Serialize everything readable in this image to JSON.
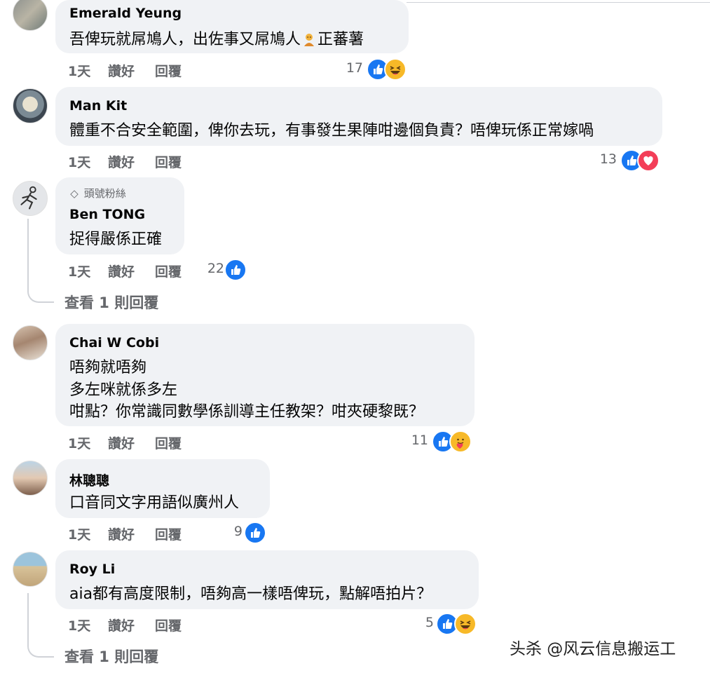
{
  "comments": [
    {
      "author": "Emerald Yeung",
      "text_parts": [
        "吾俾玩就屌鳩人，出佐事又屌鳩人",
        "正蕃薯"
      ],
      "actions": {
        "time": "1天",
        "like": "讚好",
        "reply": "回覆"
      },
      "reaction_count": "17",
      "reactions": [
        "like-icon",
        "haha-icon"
      ]
    },
    {
      "author": "Man Kit",
      "lines": [
        "體重不合安全範圍，俾你去玩，有事發生果陣咁邊個負責？唔俾玩係正常嫁喎"
      ],
      "actions": {
        "time": "1天",
        "like": "讚好",
        "reply": "回覆"
      },
      "reaction_count": "13",
      "reactions": [
        "like-icon",
        "love-icon"
      ]
    },
    {
      "badge": "頭號粉絲",
      "author": "Ben TONG",
      "lines": [
        "捉得嚴係正確"
      ],
      "actions": {
        "time": "1天",
        "like": "讚好",
        "reply": "回覆"
      },
      "reaction_count": "22",
      "reactions": [
        "like-icon"
      ],
      "view_replies": "查看 1 則回覆"
    },
    {
      "author": "Chai W Cobi",
      "lines": [
        "唔夠就唔夠",
        "多左咪就係多左",
        "咁點？你常識同數學係訓導主任教架？咁夾硬黎既？"
      ],
      "actions": {
        "time": "1天",
        "like": "讚好",
        "reply": "回覆"
      },
      "reaction_count": "11",
      "reactions": [
        "like-icon",
        "care-icon"
      ]
    },
    {
      "author": "林聰聰",
      "lines": [
        "口音同文字用語似廣州人"
      ],
      "actions": {
        "time": "1天",
        "like": "讚好",
        "reply": "回覆"
      },
      "reaction_count": "9",
      "reactions": [
        "like-icon"
      ]
    },
    {
      "author": "Roy Li",
      "lines": [
        "aia都有高度限制，唔夠高一樣唔俾玩，點解唔拍片？"
      ],
      "actions": {
        "time": "1天",
        "like": "讚好",
        "reply": "回覆"
      },
      "reaction_count": "5",
      "reactions": [
        "like-icon",
        "haha-icon"
      ],
      "view_replies": "查看 1 則回覆"
    }
  ],
  "watermark": "头杀 @风云信息搬运工",
  "colors": {
    "bubble": "#f0f2f5",
    "secondary_text": "#65676b",
    "like_blue": "#1877f2",
    "love_red": "#f33e58",
    "haha_yellow": "#f7b928"
  }
}
